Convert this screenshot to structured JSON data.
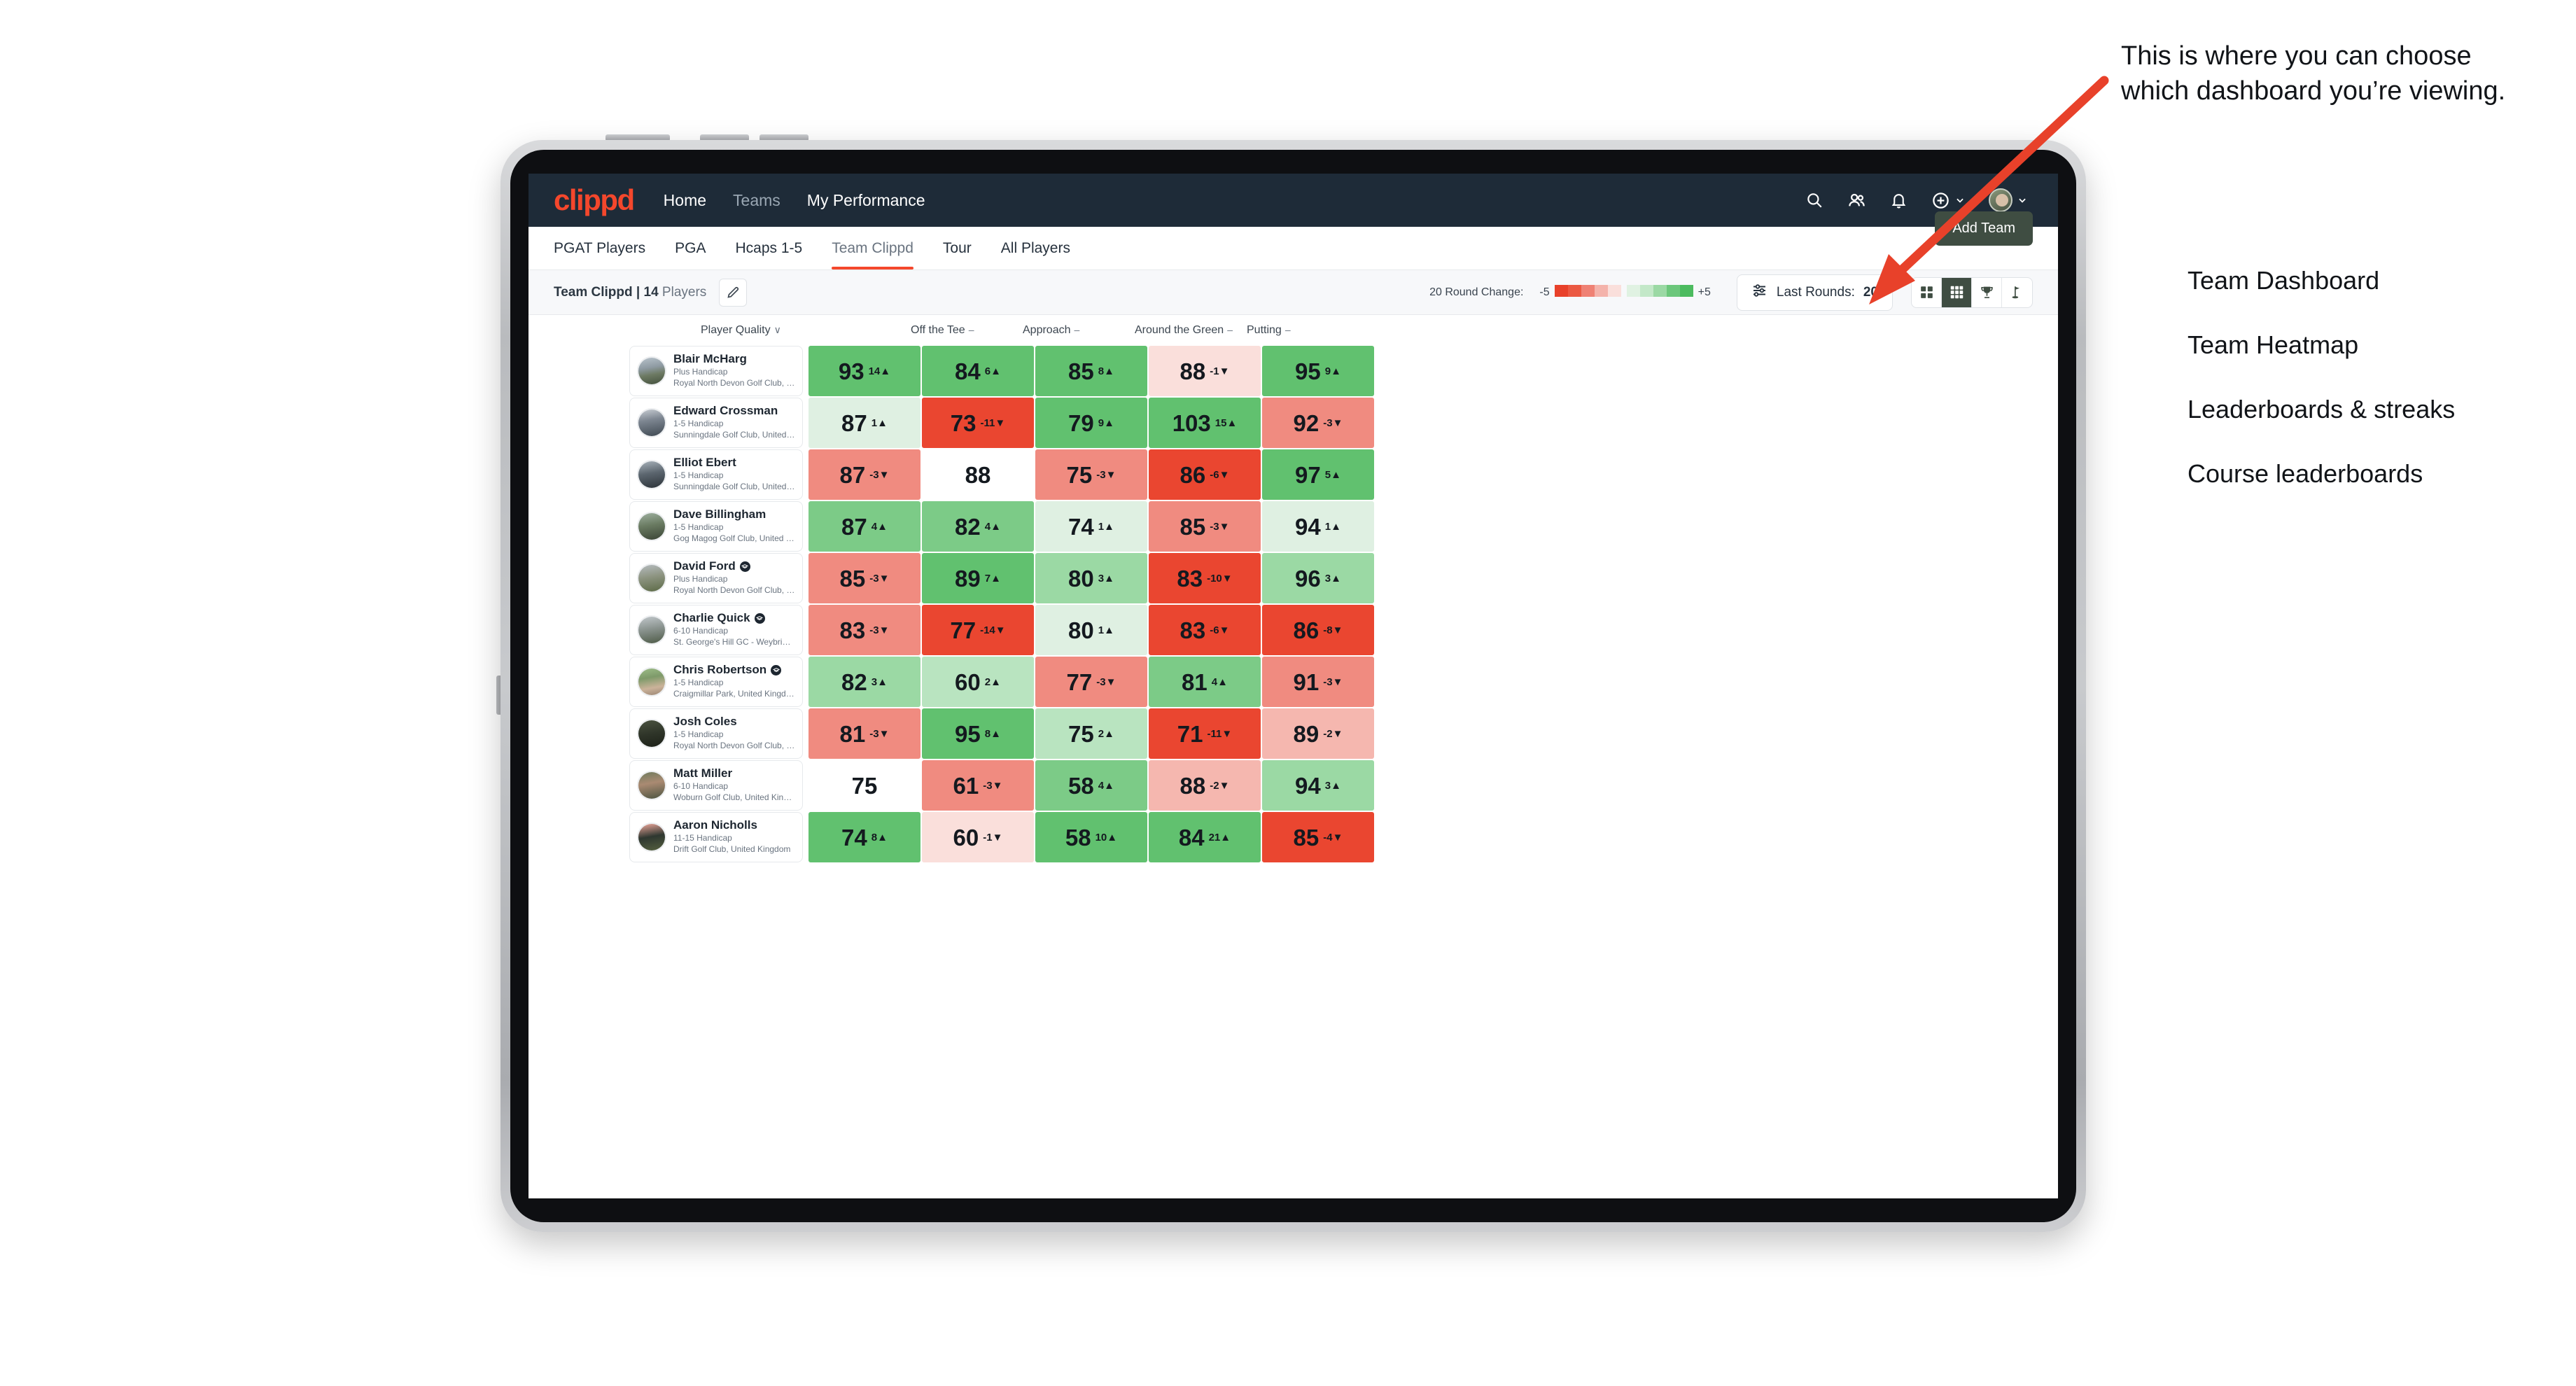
{
  "app": {
    "logo": "clippd",
    "nav": [
      {
        "label": "Home",
        "dim": false
      },
      {
        "label": "Teams",
        "dim": true
      },
      {
        "label": "My Performance",
        "dim": false
      }
    ],
    "header_icons": [
      "search-icon",
      "people-icon",
      "bell-icon",
      "plus-circle-icon",
      "avatar"
    ]
  },
  "subnav": {
    "tabs": [
      {
        "label": "PGAT Players",
        "active": false
      },
      {
        "label": "PGA",
        "active": false
      },
      {
        "label": "Hcaps 1-5",
        "active": false
      },
      {
        "label": "Team Clippd",
        "active": true
      },
      {
        "label": "Tour",
        "active": false
      },
      {
        "label": "All Players",
        "active": false
      }
    ],
    "add_team_label": "Add Team"
  },
  "controls": {
    "team_name": "Team Clippd",
    "separator": "|",
    "player_count": "14",
    "players_word": "Players",
    "edit_icon": "pencil-icon",
    "legend_label": "20 Round Change:",
    "legend_min": "-5",
    "legend_max": "+5",
    "legend_red": [
      "#e8412a",
      "#eb5942",
      "#ef8174",
      "#f4b3ab",
      "#fadfdb"
    ],
    "legend_green": [
      "#e0f2e2",
      "#c3e8c8",
      "#9bd9a4",
      "#6cc77b",
      "#4cbb5f"
    ],
    "rounds_label": "Last Rounds:",
    "rounds_value": "20",
    "rounds_icon": "sliders-icon",
    "views": [
      {
        "name": "grid-2x2-icon",
        "active": false
      },
      {
        "name": "grid-3x3-icon",
        "active": true
      },
      {
        "name": "trophy-icon",
        "active": false
      },
      {
        "name": "golf-flag-icon",
        "active": false
      }
    ]
  },
  "table": {
    "columns": [
      {
        "label": "Player Quality",
        "marker": "∨"
      },
      {
        "label": "Off the Tee",
        "marker": "–"
      },
      {
        "label": "Approach",
        "marker": "–"
      },
      {
        "label": "Around the Green",
        "marker": "–"
      },
      {
        "label": "Putting",
        "marker": "–"
      }
    ],
    "rows": [
      {
        "name": "Blair McHarg",
        "verified": false,
        "handicap": "Plus Handicap",
        "club": "Royal North Devon Golf Club, United Kingdom",
        "avatar": "linear-gradient(170deg,#b9c4cc 0%,#8e9aa2 38%,#6d7a63 62%,#43503c 100%)",
        "cells": [
          {
            "value": "93",
            "delta": "14",
            "dir": "up",
            "bg": "#61c16f"
          },
          {
            "value": "84",
            "delta": "6",
            "dir": "up",
            "bg": "#61c16f"
          },
          {
            "value": "85",
            "delta": "8",
            "dir": "up",
            "bg": "#61c16f"
          },
          {
            "value": "88",
            "delta": "-1",
            "dir": "down",
            "bg": "#fadfdb"
          },
          {
            "value": "95",
            "delta": "9",
            "dir": "up",
            "bg": "#61c16f"
          }
        ]
      },
      {
        "name": "Edward Crossman",
        "verified": false,
        "handicap": "1-5 Handicap",
        "club": "Sunningdale Golf Club, United Kingdom",
        "avatar": "linear-gradient(170deg,#c9ced4 0%,#7d8691 40%,#3e4851 100%)",
        "cells": [
          {
            "value": "87",
            "delta": "1",
            "dir": "up",
            "bg": "#dff0e2"
          },
          {
            "value": "73",
            "delta": "-11",
            "dir": "down",
            "bg": "#ea4630"
          },
          {
            "value": "79",
            "delta": "9",
            "dir": "up",
            "bg": "#61c16f"
          },
          {
            "value": "103",
            "delta": "15",
            "dir": "up",
            "bg": "#61c16f"
          },
          {
            "value": "92",
            "delta": "-3",
            "dir": "down",
            "bg": "#f08b80"
          }
        ]
      },
      {
        "name": "Elliot Ebert",
        "verified": false,
        "handicap": "1-5 Handicap",
        "club": "Sunningdale Golf Club, United Kingdom",
        "avatar": "linear-gradient(170deg,#a9b3bb 0%,#5c666f 45%,#2b3238 100%)",
        "cells": [
          {
            "value": "87",
            "delta": "-3",
            "dir": "down",
            "bg": "#f08b80"
          },
          {
            "value": "88",
            "delta": "",
            "dir": "",
            "bg": "#ffffff"
          },
          {
            "value": "75",
            "delta": "-3",
            "dir": "down",
            "bg": "#f08b80"
          },
          {
            "value": "86",
            "delta": "-6",
            "dir": "down",
            "bg": "#ea4630"
          },
          {
            "value": "97",
            "delta": "5",
            "dir": "up",
            "bg": "#61c16f"
          }
        ]
      },
      {
        "name": "Dave Billingham",
        "verified": false,
        "handicap": "1-5 Handicap",
        "club": "Gog Magog Golf Club, United Kingdom",
        "avatar": "linear-gradient(170deg,#9fb1a0 0%,#6a7b62 45%,#3a4435 100%)",
        "cells": [
          {
            "value": "87",
            "delta": "4",
            "dir": "up",
            "bg": "#7ccb87"
          },
          {
            "value": "82",
            "delta": "4",
            "dir": "up",
            "bg": "#7ccb87"
          },
          {
            "value": "74",
            "delta": "1",
            "dir": "up",
            "bg": "#dff0e2"
          },
          {
            "value": "85",
            "delta": "-3",
            "dir": "down",
            "bg": "#f08b80"
          },
          {
            "value": "94",
            "delta": "1",
            "dir": "up",
            "bg": "#dff0e2"
          }
        ]
      },
      {
        "name": "David Ford",
        "verified": true,
        "handicap": "Plus Handicap",
        "club": "Royal North Devon Golf Club, United Kingdom",
        "avatar": "linear-gradient(170deg,#b6bcc0 0%,#8d9481 45%,#5c6a46 100%)",
        "cells": [
          {
            "value": "85",
            "delta": "-3",
            "dir": "down",
            "bg": "#f08b80"
          },
          {
            "value": "89",
            "delta": "7",
            "dir": "up",
            "bg": "#61c16f"
          },
          {
            "value": "80",
            "delta": "3",
            "dir": "up",
            "bg": "#9bd9a4"
          },
          {
            "value": "83",
            "delta": "-10",
            "dir": "down",
            "bg": "#ea4630"
          },
          {
            "value": "96",
            "delta": "3",
            "dir": "up",
            "bg": "#9bd9a4"
          }
        ]
      },
      {
        "name": "Charlie Quick",
        "verified": true,
        "handicap": "6-10 Handicap",
        "club": "St. George's Hill GC - Weybridge - Surrey, Uni...",
        "avatar": "linear-gradient(170deg,#c2c8cc 0%,#8b9490 45%,#4d5a46 100%)",
        "cells": [
          {
            "value": "83",
            "delta": "-3",
            "dir": "down",
            "bg": "#f08b80"
          },
          {
            "value": "77",
            "delta": "-14",
            "dir": "down",
            "bg": "#ea4630"
          },
          {
            "value": "80",
            "delta": "1",
            "dir": "up",
            "bg": "#dff0e2"
          },
          {
            "value": "83",
            "delta": "-6",
            "dir": "down",
            "bg": "#ea4630"
          },
          {
            "value": "86",
            "delta": "-8",
            "dir": "down",
            "bg": "#ea4630"
          }
        ]
      },
      {
        "name": "Chris Robertson",
        "verified": true,
        "handicap": "1-5 Handicap",
        "club": "Craigmillar Park, United Kingdom",
        "avatar": "linear-gradient(170deg,#9dbd88 0%,#7e9a6a 35%,#cbb39a 70%,#9a8472 100%)",
        "cells": [
          {
            "value": "82",
            "delta": "3",
            "dir": "up",
            "bg": "#9bd9a4"
          },
          {
            "value": "60",
            "delta": "2",
            "dir": "up",
            "bg": "#b9e4c0"
          },
          {
            "value": "77",
            "delta": "-3",
            "dir": "down",
            "bg": "#f08b80"
          },
          {
            "value": "81",
            "delta": "4",
            "dir": "up",
            "bg": "#7ccb87"
          },
          {
            "value": "91",
            "delta": "-3",
            "dir": "down",
            "bg": "#f08b80"
          }
        ]
      },
      {
        "name": "Josh Coles",
        "verified": false,
        "handicap": "1-5 Handicap",
        "club": "Royal North Devon Golf Club, United Kingdom",
        "avatar": "linear-gradient(170deg,#4b5340 0%,#2f3529 50%,#1d2118 100%)",
        "cells": [
          {
            "value": "81",
            "delta": "-3",
            "dir": "down",
            "bg": "#f08b80"
          },
          {
            "value": "95",
            "delta": "8",
            "dir": "up",
            "bg": "#61c16f"
          },
          {
            "value": "75",
            "delta": "2",
            "dir": "up",
            "bg": "#b9e4c0"
          },
          {
            "value": "71",
            "delta": "-11",
            "dir": "down",
            "bg": "#ea4630"
          },
          {
            "value": "89",
            "delta": "-2",
            "dir": "down",
            "bg": "#f5b7af"
          }
        ]
      },
      {
        "name": "Matt Miller",
        "verified": false,
        "handicap": "6-10 Handicap",
        "club": "Woburn Golf Club, United Kingdom",
        "avatar": "linear-gradient(170deg,#6e7a5c 0%,#aa8a72 42%,#4c5441 100%)",
        "cells": [
          {
            "value": "75",
            "delta": "",
            "dir": "",
            "bg": "#ffffff"
          },
          {
            "value": "61",
            "delta": "-3",
            "dir": "down",
            "bg": "#f08b80"
          },
          {
            "value": "58",
            "delta": "4",
            "dir": "up",
            "bg": "#7ccb87"
          },
          {
            "value": "88",
            "delta": "-2",
            "dir": "down",
            "bg": "#f5b7af"
          },
          {
            "value": "94",
            "delta": "3",
            "dir": "up",
            "bg": "#9bd9a4"
          }
        ]
      },
      {
        "name": "Aaron Nicholls",
        "verified": false,
        "handicap": "11-15 Handicap",
        "club": "Drift Golf Club, United Kingdom",
        "avatar": "linear-gradient(170deg,#f0a89c 0%,#2e3730 48%,#55603f 100%)",
        "cells": [
          {
            "value": "74",
            "delta": "8",
            "dir": "up",
            "bg": "#61c16f"
          },
          {
            "value": "60",
            "delta": "-1",
            "dir": "down",
            "bg": "#fadfdb"
          },
          {
            "value": "58",
            "delta": "10",
            "dir": "up",
            "bg": "#61c16f"
          },
          {
            "value": "84",
            "delta": "21",
            "dir": "up",
            "bg": "#61c16f"
          },
          {
            "value": "85",
            "delta": "-4",
            "dir": "down",
            "bg": "#ea4630"
          }
        ]
      }
    ]
  },
  "annotation": {
    "callout": "This is where you can choose which dashboard you’re viewing.",
    "arrow_color": "#e8412a",
    "items": [
      "Team Dashboard",
      "Team Heatmap",
      "Leaderboards & streaks",
      "Course leaderboards"
    ]
  }
}
